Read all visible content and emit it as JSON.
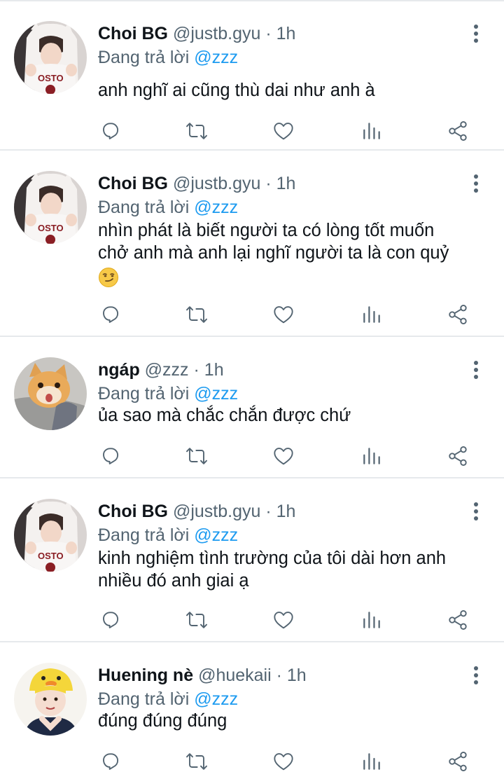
{
  "reply_prefix": "Đang trả lời",
  "tweets": [
    {
      "name": "Choi BG",
      "handle": "@justb.gyu",
      "time": "· 1h",
      "reply_to": "@zzz",
      "text_lines": [
        "anh nghĩ ai cũng thù dai như anh à"
      ],
      "avatar": "boy-hoodie-avatar"
    },
    {
      "name": "Choi BG",
      "handle": "@justb.gyu",
      "time": "· 1h",
      "reply_to": "@zzz",
      "text_lines": [
        "nhìn phát là biết người ta có lòng tốt muốn",
        "chở anh mà anh lại nghĩ người ta là con quỷ"
      ],
      "emoji": "smirking-face-emoji",
      "avatar": "boy-hoodie-avatar"
    },
    {
      "name": "ngáp",
      "handle": "@zzz",
      "time": "· 1h",
      "reply_to": "@zzz",
      "text_lines": [
        "ủa sao mà chắc chắn được chứ"
      ],
      "avatar": "cat-avatar"
    },
    {
      "name": "Choi BG",
      "handle": "@justb.gyu",
      "time": "· 1h",
      "reply_to": "@zzz",
      "text_lines": [
        "kinh nghiệm tình trường của tôi dài hơn anh",
        "nhiều đó anh giai ạ"
      ],
      "avatar": "boy-hoodie-avatar"
    },
    {
      "name": "Huening nè",
      "handle": "@huekaii",
      "time": "· 1h",
      "reply_to": "@zzz",
      "text_lines": [
        "đúng đúng đúng"
      ],
      "avatar": "boy-duck-hat-avatar"
    }
  ],
  "icons": {
    "reply": "comment-icon",
    "retweet": "retweet-icon",
    "like": "heart-icon",
    "views": "analytics-icon",
    "share": "share-icon",
    "more": "more-vertical-icon"
  },
  "colors": {
    "mention": "#1d9bf0",
    "secondary_text": "#536471",
    "icon": "#536471",
    "divider": "#e6e9ec"
  }
}
